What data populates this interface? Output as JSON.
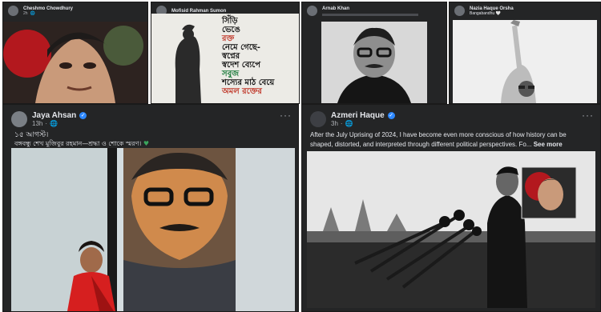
{
  "colors": {
    "card_bg": "#242526",
    "text": "#e4e6eb",
    "muted": "#b0b3b8",
    "verified": "#2d88ff",
    "green_emoji": "#3ba55d"
  },
  "posts": [
    {
      "author": "Cheshmo Chowdhury",
      "time": "2h",
      "body": "",
      "image_alt": "Painted portrait of man with dark hair against red background"
    },
    {
      "author": "Mofisid Rahman Sumon",
      "time": "",
      "body": "",
      "image_poem": [
        "সিঁড়ি",
        "ভেঙে",
        "রক্ত",
        "নেমে গেছে-",
        "স্বপ্নের",
        "স্বদেশ ব্যেপে",
        "সবুজ",
        "শস্যের মাঠ বেয়ে",
        "অমল রক্তের"
      ]
    },
    {
      "author": "Arnab Khan",
      "time": "",
      "body": "",
      "image_alt": "Black and white portrait with glasses and moustache"
    },
    {
      "author": "Nazia Haque Orsha",
      "time": "",
      "body": "Bangabandhu 🤍",
      "image_alt": "Sketch of a man raising his hand"
    },
    {
      "author": "Jaya Ahsan",
      "time": "13h",
      "body_line1": "১৫ আগস্ট।",
      "body_line2": "বঙ্গবন্ধু শেখ মুজিবুর রহমান—শ্রদ্ধা ও শোকে স্মরণ।",
      "image_alt": "Woman in red sari standing before a mosaic portrait"
    },
    {
      "author": "Azmeri Haque",
      "time": "3h",
      "body": "After the July Uprising of 2024, I have become even more conscious of how history can be shaped, distorted, and interpreted through different political perspectives. Fo...",
      "see_more": "See more",
      "image_alt": "Black and white photo of speaker at microphones with inset portrait"
    }
  ]
}
